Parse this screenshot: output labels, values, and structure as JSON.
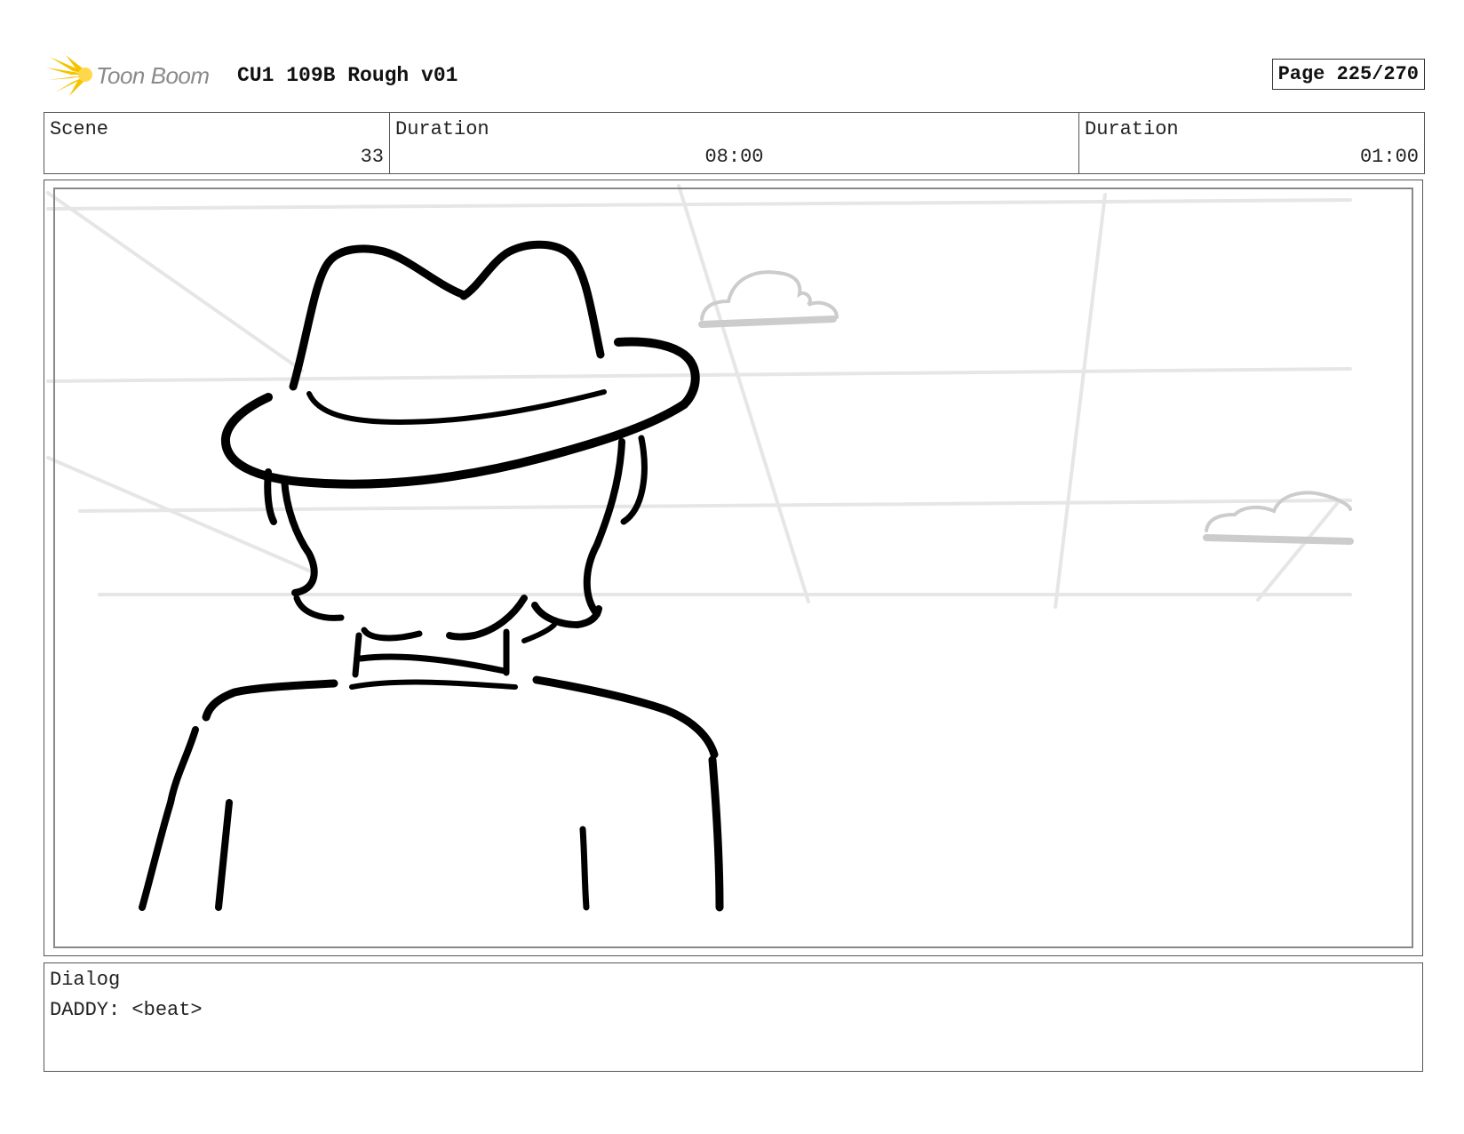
{
  "header": {
    "brand": "Toon Boom",
    "title": "CU1 109B Rough v01",
    "page": "Page 225/270"
  },
  "info": {
    "scene_label": "Scene",
    "scene_value": "33",
    "duration1_label": "Duration",
    "duration1_value": "08:00",
    "duration2_label": "Duration",
    "duration2_value": "01:00"
  },
  "dialog": {
    "label": "Dialog",
    "text": "DADDY: <beat>"
  },
  "colors": {
    "logo_accent": "#f5c400",
    "sketch_line": "#000000",
    "background_line": "#e4e4e4"
  }
}
